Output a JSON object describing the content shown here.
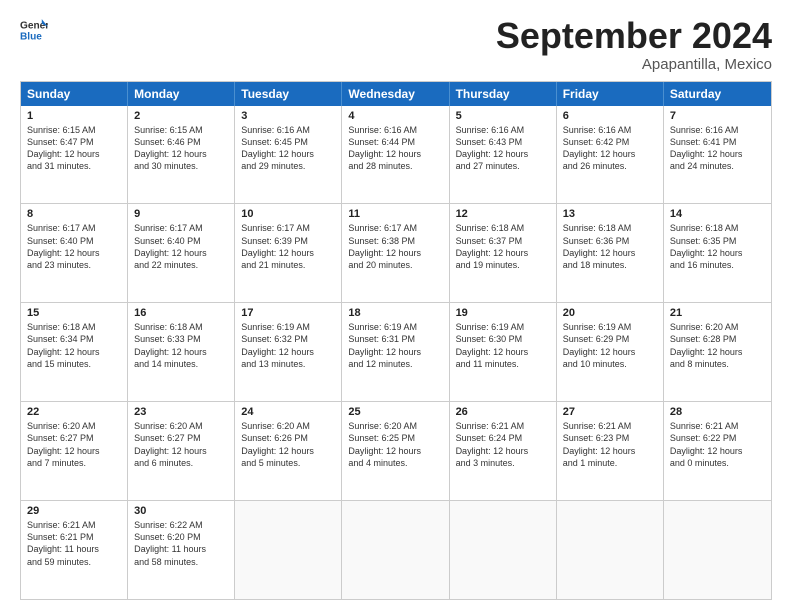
{
  "logo": {
    "line1": "General",
    "line2": "Blue"
  },
  "header": {
    "month": "September 2024",
    "location": "Apapantilla, Mexico"
  },
  "weekdays": [
    "Sunday",
    "Monday",
    "Tuesday",
    "Wednesday",
    "Thursday",
    "Friday",
    "Saturday"
  ],
  "rows": [
    [
      {
        "day": "1",
        "info": "Sunrise: 6:15 AM\nSunset: 6:47 PM\nDaylight: 12 hours\nand 31 minutes."
      },
      {
        "day": "2",
        "info": "Sunrise: 6:15 AM\nSunset: 6:46 PM\nDaylight: 12 hours\nand 30 minutes."
      },
      {
        "day": "3",
        "info": "Sunrise: 6:16 AM\nSunset: 6:45 PM\nDaylight: 12 hours\nand 29 minutes."
      },
      {
        "day": "4",
        "info": "Sunrise: 6:16 AM\nSunset: 6:44 PM\nDaylight: 12 hours\nand 28 minutes."
      },
      {
        "day": "5",
        "info": "Sunrise: 6:16 AM\nSunset: 6:43 PM\nDaylight: 12 hours\nand 27 minutes."
      },
      {
        "day": "6",
        "info": "Sunrise: 6:16 AM\nSunset: 6:42 PM\nDaylight: 12 hours\nand 26 minutes."
      },
      {
        "day": "7",
        "info": "Sunrise: 6:16 AM\nSunset: 6:41 PM\nDaylight: 12 hours\nand 24 minutes."
      }
    ],
    [
      {
        "day": "8",
        "info": "Sunrise: 6:17 AM\nSunset: 6:40 PM\nDaylight: 12 hours\nand 23 minutes."
      },
      {
        "day": "9",
        "info": "Sunrise: 6:17 AM\nSunset: 6:40 PM\nDaylight: 12 hours\nand 22 minutes."
      },
      {
        "day": "10",
        "info": "Sunrise: 6:17 AM\nSunset: 6:39 PM\nDaylight: 12 hours\nand 21 minutes."
      },
      {
        "day": "11",
        "info": "Sunrise: 6:17 AM\nSunset: 6:38 PM\nDaylight: 12 hours\nand 20 minutes."
      },
      {
        "day": "12",
        "info": "Sunrise: 6:18 AM\nSunset: 6:37 PM\nDaylight: 12 hours\nand 19 minutes."
      },
      {
        "day": "13",
        "info": "Sunrise: 6:18 AM\nSunset: 6:36 PM\nDaylight: 12 hours\nand 18 minutes."
      },
      {
        "day": "14",
        "info": "Sunrise: 6:18 AM\nSunset: 6:35 PM\nDaylight: 12 hours\nand 16 minutes."
      }
    ],
    [
      {
        "day": "15",
        "info": "Sunrise: 6:18 AM\nSunset: 6:34 PM\nDaylight: 12 hours\nand 15 minutes."
      },
      {
        "day": "16",
        "info": "Sunrise: 6:18 AM\nSunset: 6:33 PM\nDaylight: 12 hours\nand 14 minutes."
      },
      {
        "day": "17",
        "info": "Sunrise: 6:19 AM\nSunset: 6:32 PM\nDaylight: 12 hours\nand 13 minutes."
      },
      {
        "day": "18",
        "info": "Sunrise: 6:19 AM\nSunset: 6:31 PM\nDaylight: 12 hours\nand 12 minutes."
      },
      {
        "day": "19",
        "info": "Sunrise: 6:19 AM\nSunset: 6:30 PM\nDaylight: 12 hours\nand 11 minutes."
      },
      {
        "day": "20",
        "info": "Sunrise: 6:19 AM\nSunset: 6:29 PM\nDaylight: 12 hours\nand 10 minutes."
      },
      {
        "day": "21",
        "info": "Sunrise: 6:20 AM\nSunset: 6:28 PM\nDaylight: 12 hours\nand 8 minutes."
      }
    ],
    [
      {
        "day": "22",
        "info": "Sunrise: 6:20 AM\nSunset: 6:27 PM\nDaylight: 12 hours\nand 7 minutes."
      },
      {
        "day": "23",
        "info": "Sunrise: 6:20 AM\nSunset: 6:27 PM\nDaylight: 12 hours\nand 6 minutes."
      },
      {
        "day": "24",
        "info": "Sunrise: 6:20 AM\nSunset: 6:26 PM\nDaylight: 12 hours\nand 5 minutes."
      },
      {
        "day": "25",
        "info": "Sunrise: 6:20 AM\nSunset: 6:25 PM\nDaylight: 12 hours\nand 4 minutes."
      },
      {
        "day": "26",
        "info": "Sunrise: 6:21 AM\nSunset: 6:24 PM\nDaylight: 12 hours\nand 3 minutes."
      },
      {
        "day": "27",
        "info": "Sunrise: 6:21 AM\nSunset: 6:23 PM\nDaylight: 12 hours\nand 1 minute."
      },
      {
        "day": "28",
        "info": "Sunrise: 6:21 AM\nSunset: 6:22 PM\nDaylight: 12 hours\nand 0 minutes."
      }
    ],
    [
      {
        "day": "29",
        "info": "Sunrise: 6:21 AM\nSunset: 6:21 PM\nDaylight: 11 hours\nand 59 minutes."
      },
      {
        "day": "30",
        "info": "Sunrise: 6:22 AM\nSunset: 6:20 PM\nDaylight: 11 hours\nand 58 minutes."
      },
      {
        "day": "",
        "info": ""
      },
      {
        "day": "",
        "info": ""
      },
      {
        "day": "",
        "info": ""
      },
      {
        "day": "",
        "info": ""
      },
      {
        "day": "",
        "info": ""
      }
    ]
  ]
}
